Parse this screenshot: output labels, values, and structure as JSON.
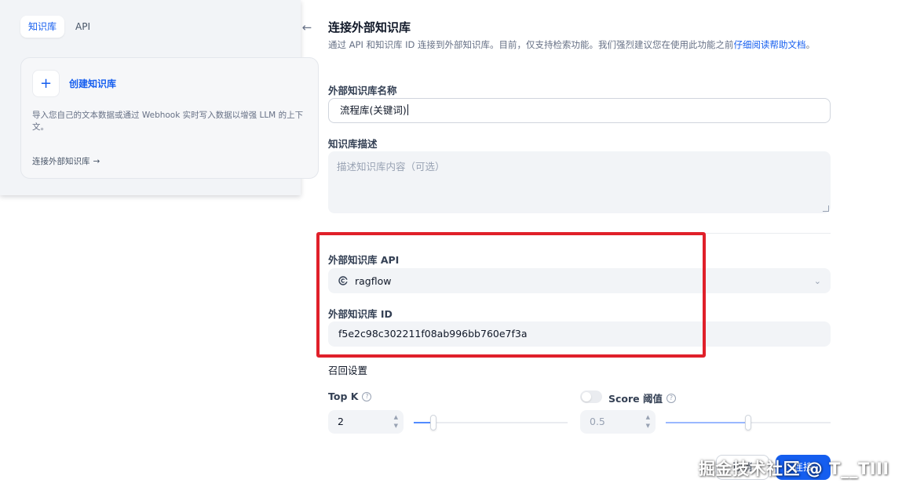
{
  "left_panel": {
    "tabs": [
      {
        "label": "知识库",
        "active": true
      },
      {
        "label": "API",
        "active": false
      }
    ],
    "create_card": {
      "plus": "+",
      "title": "创建知识库",
      "description": "导入您自己的文本数据或通过 Webhook 实时写入数据以增强 LLM 的上下文。",
      "connect_link": "连接外部知识库",
      "connect_arrow": "→"
    }
  },
  "back_arrow": "←",
  "form": {
    "title": "连接外部知识库",
    "description_prefix": "通过 API 和知识库 ID 连接到外部知识库。目前，仅支持检索功能。我们强烈建议您在使用此功能之前",
    "description_link": "仔细阅读帮助文档",
    "description_suffix": "。",
    "name_label": "外部知识库名称",
    "name_value": "流程库(关键词)",
    "desc_label": "知识库描述",
    "desc_placeholder": "描述知识库内容（可选）",
    "api_label": "外部知识库 API",
    "api_value": "ragflow",
    "id_label": "外部知识库 ID",
    "id_value": "f5e2c98c302211f08ab996bb760e7f3a",
    "retrieval_label": "召回设置",
    "top_k": {
      "label": "Top K",
      "value": "2",
      "help": "?",
      "slider_fraction": 0.13
    },
    "score": {
      "label": "Score 阈值",
      "value": "0.5",
      "help": "?",
      "enabled": false,
      "slider_fraction": 0.5
    },
    "cancel_label": "取消",
    "save_label": "连接"
  },
  "watermark": "掘金技术社区 @ T__TIII",
  "colors": {
    "accent": "#155eef",
    "highlight": "#e0202a"
  }
}
